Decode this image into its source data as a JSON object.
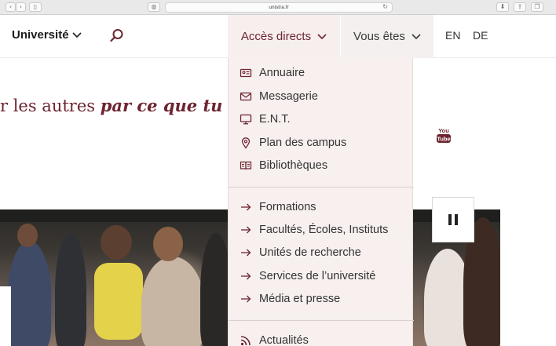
{
  "browser": {
    "url": "unistra.fr"
  },
  "header": {
    "brand": "Université",
    "nav": {
      "acces_directs": "Accès directs",
      "vous_etes": "Vous êtes"
    },
    "languages": [
      "EN",
      "DE"
    ]
  },
  "hero": {
    "tagline_start": "r les autres ",
    "tagline_emphasis": "par ce que tu es.",
    "youtube_label": "You Tube"
  },
  "dropdown": {
    "quick_links": [
      {
        "label": "Annuaire",
        "icon": "id-card-icon"
      },
      {
        "label": "Messagerie",
        "icon": "envelope-icon"
      },
      {
        "label": "E.N.T.",
        "icon": "monitor-icon"
      },
      {
        "label": "Plan des campus",
        "icon": "map-pin-icon"
      },
      {
        "label": "Bibliothèques",
        "icon": "book-icon"
      }
    ],
    "sections": [
      {
        "label": "Formations",
        "icon": "arrow-right-icon"
      },
      {
        "label": "Facultés, Écoles, Instituts",
        "icon": "arrow-right-icon"
      },
      {
        "label": "Unités de recherche",
        "icon": "arrow-right-icon"
      },
      {
        "label": "Services de l’université",
        "icon": "arrow-right-icon"
      },
      {
        "label": "Média et presse",
        "icon": "arrow-right-icon"
      }
    ],
    "news": [
      {
        "label": "Actualités",
        "icon": "rss-icon"
      }
    ]
  },
  "colors": {
    "accent": "#6d2430",
    "dropdown_bg": "#f7f0ef"
  }
}
